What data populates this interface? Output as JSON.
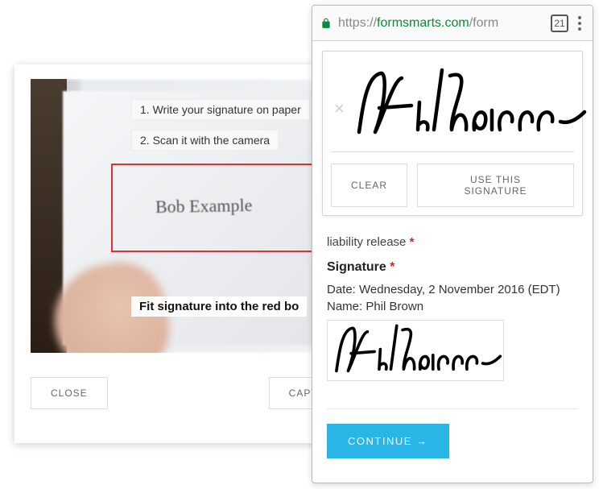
{
  "capture": {
    "instruction1": "1. Write your signature on paper",
    "instruction2": "2. Scan it with the camera",
    "fit_instruction": "Fit signature into the red bo",
    "scanned_name": "Bob Example",
    "close_label": "CLOSE",
    "capture_label": "CAPTURE"
  },
  "browser": {
    "url_prefix": "https://",
    "url_host": "formsmarts.com",
    "url_path": "/form",
    "tab_count": "21"
  },
  "signature_modal": {
    "clear_label": "CLEAR",
    "use_label": "USE THIS SIGNATURE",
    "close_symbol": "×"
  },
  "form": {
    "incomplete_field": "liability release",
    "section_heading": "Signature",
    "date_label": "Date:",
    "date_value": "Wednesday, 2 November 2016 (EDT)",
    "name_label": "Name:",
    "name_value": "Phil Brown",
    "continue_label": "CONTINUE →",
    "required_marker": "*"
  }
}
